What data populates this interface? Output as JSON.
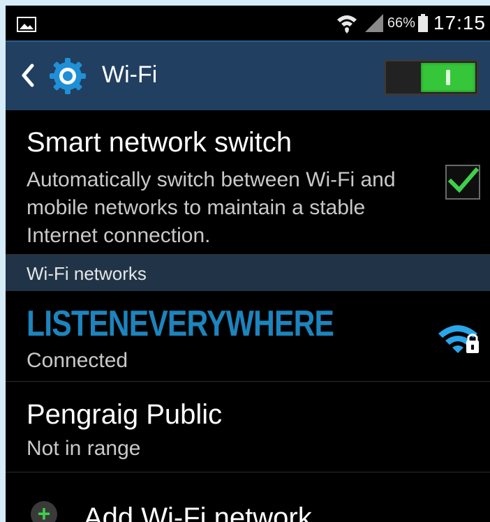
{
  "status_bar": {
    "left_icon": "picture-icon",
    "battery_percent": "66%",
    "time": "17:15",
    "icons": [
      "wifi-icon",
      "signal-icon",
      "battery-icon"
    ]
  },
  "action_bar": {
    "title": "Wi-Fi",
    "wifi_enabled": true,
    "icons": [
      "back-arrow-icon",
      "gear-icon"
    ],
    "accent": "#213f60",
    "toggle_color": "#36c63a"
  },
  "smart_switch": {
    "title": "Smart network switch",
    "description": "Automatically switch between Wi-Fi and mobile networks to maintain a stable Internet connection.",
    "checked": true
  },
  "networks_section": {
    "header": "Wi-Fi networks",
    "networks": [
      {
        "name": "LISTENEVERYWHERE",
        "status": "Connected",
        "secured": true,
        "name_color": "#1d84bd"
      },
      {
        "name": "Pengraig Public",
        "status": "Not in range"
      }
    ]
  },
  "add_network": {
    "label": "Add Wi-Fi network",
    "icon": "plus-icon"
  }
}
